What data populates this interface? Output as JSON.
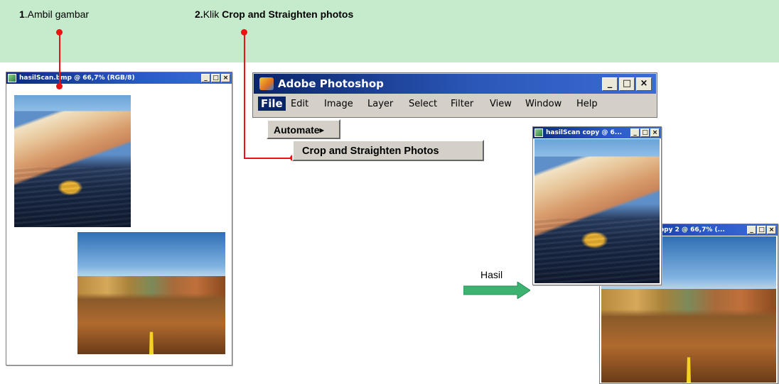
{
  "banner": {
    "step1_num": "1",
    "step1_text": ".Ambil gambar",
    "step2_num": "2.",
    "step2_text": "Klik ",
    "step2_bold": "Crop and Straighten photos"
  },
  "source_window": {
    "title": "hasilScan.bmp @ 66,7% (RGB/8)",
    "controls": [
      "_",
      "□",
      "×"
    ]
  },
  "photoshop": {
    "title": "Adobe Photoshop",
    "controls": [
      "_",
      "□",
      "×"
    ],
    "menu": [
      "File",
      "Edit",
      "Image",
      "Layer",
      "Select",
      "Filter",
      "View",
      "Window",
      "Help"
    ],
    "automate": "Automate",
    "automate_arrow": "▶",
    "crop_item": "Crop and Straighten Photos"
  },
  "result": {
    "label": "Hasil",
    "copy1_title": "hasilScan copy @ 6...",
    "copy2_title": "opy 2 @ 66,7% (...",
    "controls": [
      "_",
      "□",
      "×"
    ]
  },
  "colors": {
    "banner": "#c6ebcc",
    "callout": "#e11111",
    "arrow": "#3cb371",
    "titlebar": "#0a246a"
  },
  "icons": [
    "photoshop-logo-icon",
    "document-icon",
    "minimize-icon",
    "maximize-icon",
    "close-icon",
    "submenu-arrow-icon",
    "right-arrow-icon"
  ]
}
